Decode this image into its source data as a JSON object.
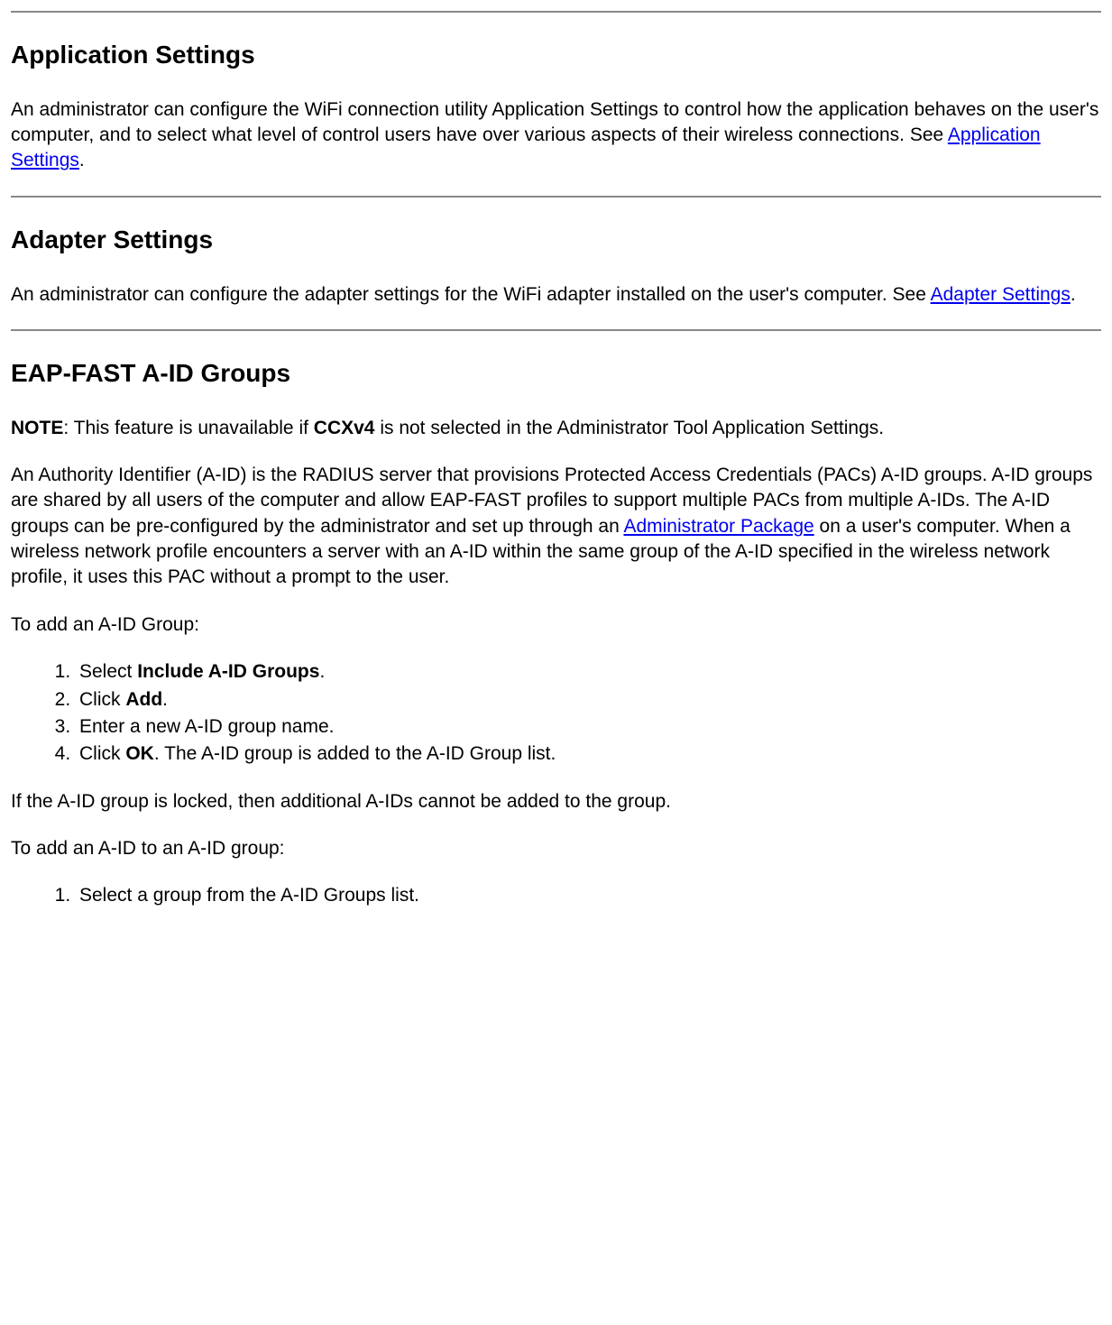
{
  "section1": {
    "heading": "Application Settings",
    "para_a": "An administrator can configure the WiFi connection utility Application Settings to control how the application behaves on the user's computer, and to select what level of control users have over various aspects of their wireless connections. See ",
    "link": "Application Settings",
    "para_b": "."
  },
  "section2": {
    "heading": "Adapter Settings",
    "para_a": "An administrator can configure the adapter settings for the WiFi adapter installed on the user's computer. See ",
    "link": "Adapter Settings",
    "para_b": "."
  },
  "section3": {
    "heading": "EAP-FAST A-ID Groups",
    "note_label": "NOTE",
    "note_a": ": This feature is unavailable if ",
    "note_bold": "CCXv4",
    "note_b": " is not selected in the Administrator Tool Application Settings.",
    "para2_a": "An Authority Identifier (A-ID) is the RADIUS server that provisions Protected Access Credentials (PACs) A-ID groups. A-ID groups are shared by all users of the computer and allow EAP-FAST profiles to support multiple PACs from multiple A-IDs. The A-ID groups can be pre-configured by the administrator and set up through an ",
    "para2_link": "Administrator Package",
    "para2_b": " on a user's computer. When a wireless network profile encounters a server with an A-ID within the same group of the A-ID specified in the wireless network profile, it uses this PAC without a prompt to the user.",
    "addGroupIntro": "To add an A-ID Group:",
    "steps1": {
      "s1a": "Select ",
      "s1b": "Include A-ID Groups",
      "s1c": ".",
      "s2a": "Click ",
      "s2b": "Add",
      "s2c": ".",
      "s3": "Enter a new A-ID group name.",
      "s4a": "Click ",
      "s4b": "OK",
      "s4c": ". The A-ID group is added to the A-ID Group list."
    },
    "lockedNote": "If the A-ID group is locked, then additional A-IDs cannot be added to the group.",
    "addAidIntro": "To add an A-ID to an A-ID group:",
    "steps2": {
      "s1": "Select a group from the A-ID Groups list."
    }
  }
}
